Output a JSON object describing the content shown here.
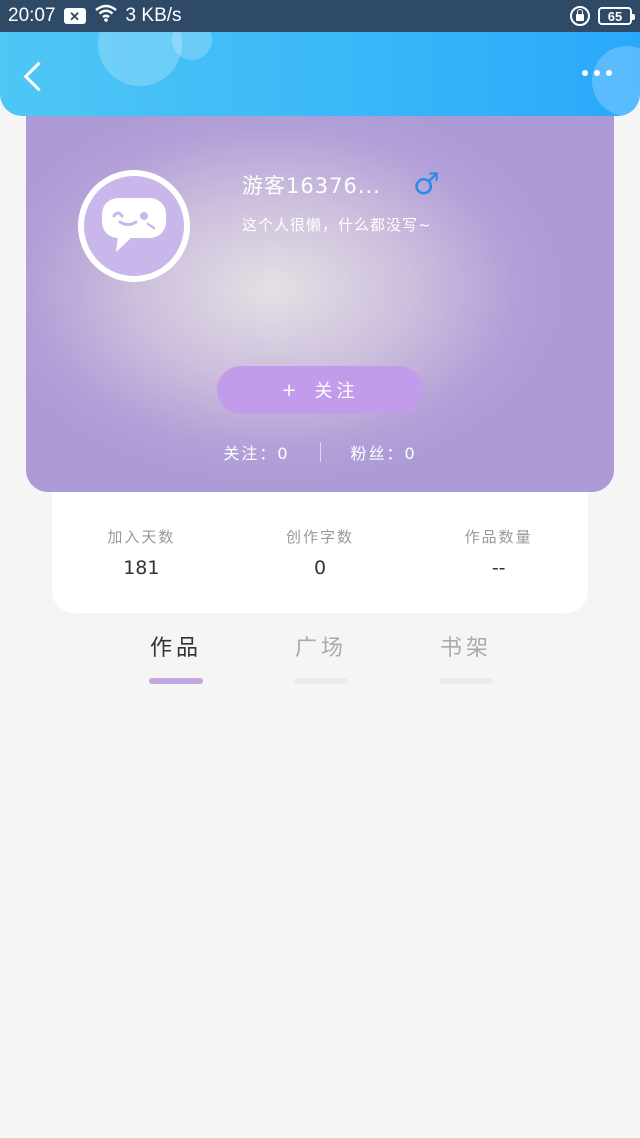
{
  "status_bar": {
    "time": "20:07",
    "notification_icon": "close-box-icon",
    "wifi_icon": "wifi-icon",
    "network_speed": "3 KB/s",
    "lock_icon": "rotation-lock-icon",
    "battery": "65"
  },
  "header": {
    "back_icon": "chevron-left-icon",
    "more_icon": "more-dots-icon",
    "colors": {
      "start": "#4fc7f5",
      "end": "#2aa8fb"
    }
  },
  "profile": {
    "avatar_icon": "chat-bubble-face-icon",
    "username": "游客16376...",
    "gender_symbol": "♂",
    "bio": "这个人很懒，什么都没写~",
    "follow_button": {
      "plus": "+",
      "label": "关注"
    },
    "following": "关注：0",
    "followers": "粉丝：0"
  },
  "stats": [
    {
      "label": "加入天数",
      "value": "181"
    },
    {
      "label": "创作字数",
      "value": "0"
    },
    {
      "label": "作品数量",
      "value": "--"
    }
  ],
  "tabs": [
    {
      "label": "作品",
      "active": true
    },
    {
      "label": "广场",
      "active": false
    },
    {
      "label": "书架",
      "active": false
    }
  ]
}
